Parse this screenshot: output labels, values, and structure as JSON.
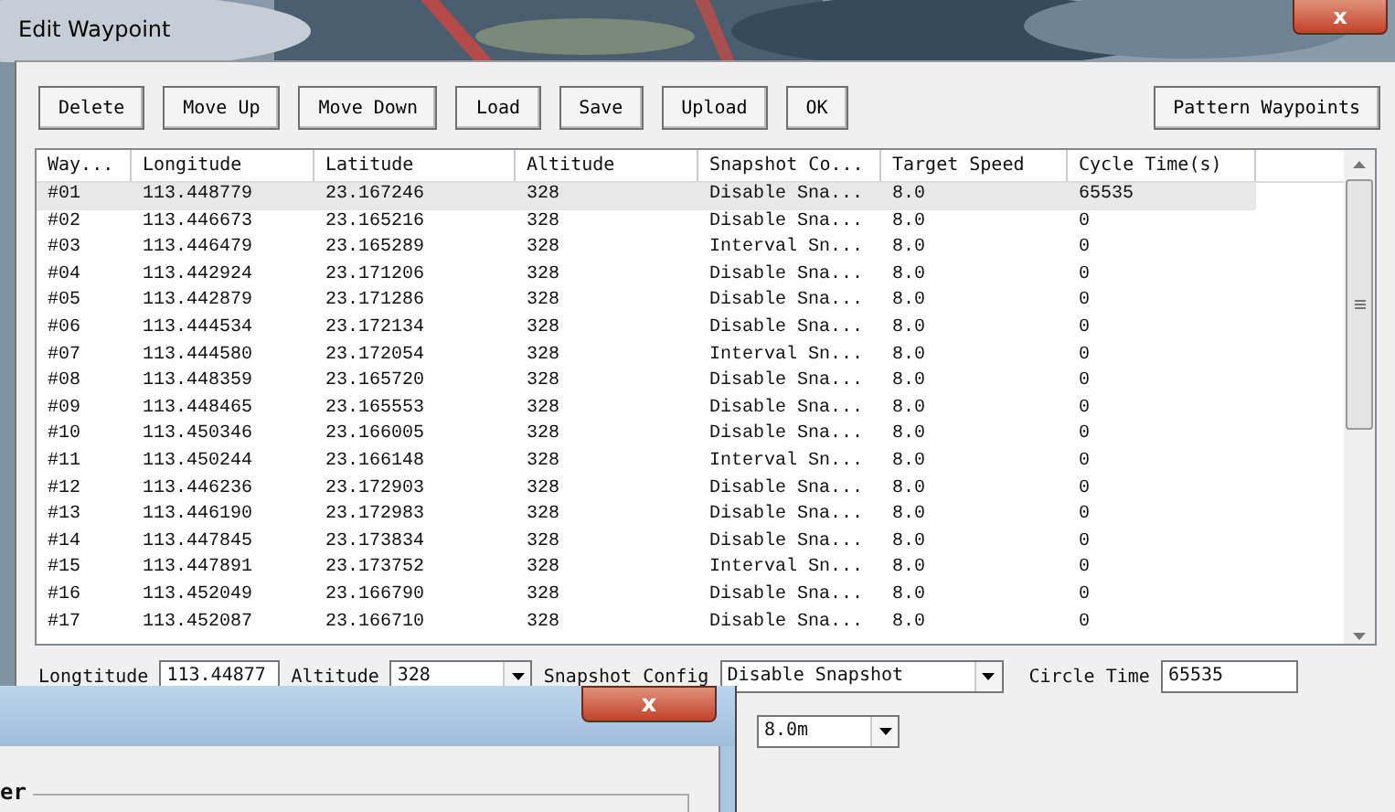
{
  "window": {
    "title": "Edit Waypoint",
    "close": "x"
  },
  "toolbar": [
    "Delete",
    "Move Up",
    "Move Down",
    "Load",
    "Save",
    "Upload",
    "OK"
  ],
  "pattern_button": "Pattern Waypoints",
  "table": {
    "columns": [
      "Way...",
      "Longitude",
      "Latitude",
      "Altitude",
      "Snapshot Co...",
      "Target Speed",
      "Cycle Time(s)"
    ],
    "rows": [
      {
        "cells": [
          "#01",
          "113.448779",
          "23.167246",
          "328",
          "Disable Sna...",
          "8.0",
          "65535"
        ],
        "selected": true
      },
      {
        "cells": [
          "#02",
          "113.446673",
          "23.165216",
          "328",
          "Disable Sna...",
          "8.0",
          "0"
        ],
        "selected": false
      },
      {
        "cells": [
          "#03",
          "113.446479",
          "23.165289",
          "328",
          "Interval Sn...",
          "8.0",
          "0"
        ],
        "selected": false
      },
      {
        "cells": [
          "#04",
          "113.442924",
          "23.171206",
          "328",
          "Disable Sna...",
          "8.0",
          "0"
        ],
        "selected": false
      },
      {
        "cells": [
          "#05",
          "113.442879",
          "23.171286",
          "328",
          "Disable Sna...",
          "8.0",
          "0"
        ],
        "selected": false
      },
      {
        "cells": [
          "#06",
          "113.444534",
          "23.172134",
          "328",
          "Disable Sna...",
          "8.0",
          "0"
        ],
        "selected": false
      },
      {
        "cells": [
          "#07",
          "113.444580",
          "23.172054",
          "328",
          "Interval Sn...",
          "8.0",
          "0"
        ],
        "selected": false
      },
      {
        "cells": [
          "#08",
          "113.448359",
          "23.165720",
          "328",
          "Disable Sna...",
          "8.0",
          "0"
        ],
        "selected": false
      },
      {
        "cells": [
          "#09",
          "113.448465",
          "23.165553",
          "328",
          "Disable Sna...",
          "8.0",
          "0"
        ],
        "selected": false
      },
      {
        "cells": [
          "#10",
          "113.450346",
          "23.166005",
          "328",
          "Disable Sna...",
          "8.0",
          "0"
        ],
        "selected": false
      },
      {
        "cells": [
          "#11",
          "113.450244",
          "23.166148",
          "328",
          "Interval Sn...",
          "8.0",
          "0"
        ],
        "selected": false
      },
      {
        "cells": [
          "#12",
          "113.446236",
          "23.172903",
          "328",
          "Disable Sna...",
          "8.0",
          "0"
        ],
        "selected": false
      },
      {
        "cells": [
          "#13",
          "113.446190",
          "23.172983",
          "328",
          "Disable Sna...",
          "8.0",
          "0"
        ],
        "selected": false
      },
      {
        "cells": [
          "#14",
          "113.447845",
          "23.173834",
          "328",
          "Disable Sna...",
          "8.0",
          "0"
        ],
        "selected": false
      },
      {
        "cells": [
          "#15",
          "113.447891",
          "23.173752",
          "328",
          "Interval Sn...",
          "8.0",
          "0"
        ],
        "selected": false
      },
      {
        "cells": [
          "#16",
          "113.452049",
          "23.166790",
          "328",
          "Disable Sna...",
          "8.0",
          "0"
        ],
        "selected": false
      },
      {
        "cells": [
          "#17",
          "113.452087",
          "23.166710",
          "328",
          "Disable Sna...",
          "8.0",
          "0"
        ],
        "selected": false
      }
    ]
  },
  "fields": {
    "longitude_label": "Longtitude",
    "longitude": "113.44877",
    "altitude_label": "Altitude",
    "altitude": "328",
    "snapshot_label": "Snapshot Config",
    "snapshot": "Disable Snapshot",
    "circle_label": "Circle Time",
    "circle": "65535",
    "speed": "8.0m"
  },
  "overlay_window": {
    "close": "x",
    "group_label": "er"
  }
}
